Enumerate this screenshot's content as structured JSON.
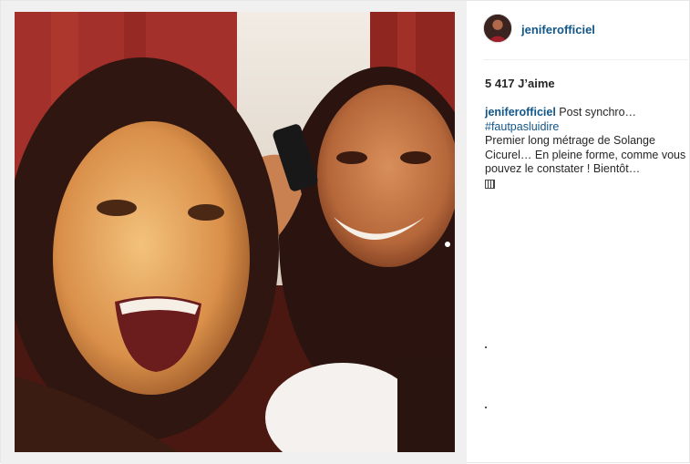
{
  "post": {
    "username": "jeniferofficiel",
    "likes_text": "5 417 J’aime",
    "caption": {
      "username": "jeniferofficiel",
      "text": "Post synchro…",
      "hashtag": "#fautpasluidire",
      "body": "Premier long métrage de Solange Cicurel… En pleine forme, comme vous pouvez le constater ! Bientôt…"
    },
    "icons": {
      "avatar": "profile-avatar",
      "caption_end": "clapperboard-icon"
    }
  },
  "colors": {
    "link": "#125688",
    "text": "#262626",
    "border": "#efefef"
  }
}
